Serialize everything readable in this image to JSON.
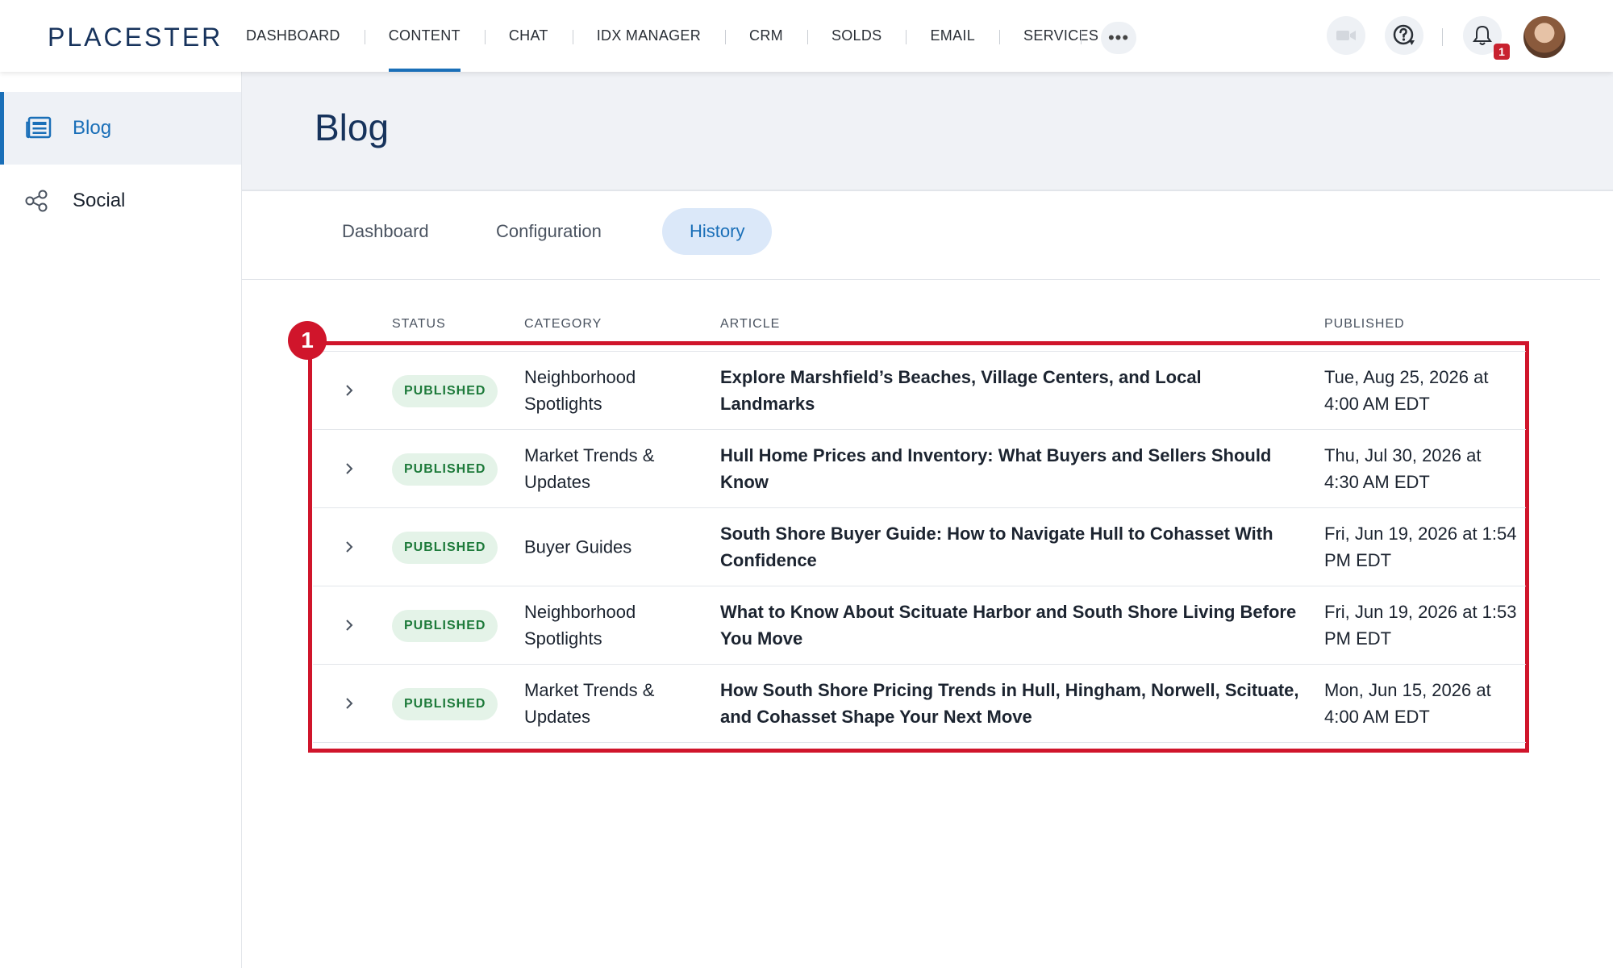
{
  "brand": {
    "logo": "PLACESTER"
  },
  "nav": {
    "items": [
      {
        "label": "DASHBOARD",
        "active": false
      },
      {
        "label": "CONTENT",
        "active": true
      },
      {
        "label": "CHAT",
        "active": false
      },
      {
        "label": "IDX MANAGER",
        "active": false
      },
      {
        "label": "CRM",
        "active": false
      },
      {
        "label": "SOLDS",
        "active": false
      },
      {
        "label": "EMAIL",
        "active": false
      },
      {
        "label": "SERVICES",
        "active": false
      }
    ],
    "more_label": "•••",
    "notification_count": "1"
  },
  "sidebar": {
    "items": [
      {
        "label": "Blog",
        "icon": "newspaper-icon",
        "active": true
      },
      {
        "label": "Social",
        "icon": "share-icon",
        "active": false
      }
    ]
  },
  "page": {
    "title": "Blog"
  },
  "tabs": [
    {
      "label": "Dashboard",
      "active": false
    },
    {
      "label": "Configuration",
      "active": false
    },
    {
      "label": "History",
      "active": true
    }
  ],
  "table": {
    "headers": {
      "status": "STATUS",
      "category": "CATEGORY",
      "article": "ARTICLE",
      "published": "PUBLISHED"
    },
    "rows": [
      {
        "status": "PUBLISHED",
        "category": "Neighborhood Spotlights",
        "article": "Explore Marshfield’s Beaches, Village Centers, and Local Landmarks",
        "published": "Tue, Aug 25, 2026 at 4:00 AM EDT"
      },
      {
        "status": "PUBLISHED",
        "category": "Market Trends & Updates",
        "article": "Hull Home Prices and Inventory: What Buyers and Sellers Should Know",
        "published": "Thu, Jul 30, 2026 at 4:30 AM EDT"
      },
      {
        "status": "PUBLISHED",
        "category": "Buyer Guides",
        "article": "South Shore Buyer Guide: How to Navigate Hull to Cohasset With Confidence",
        "published": "Fri, Jun 19, 2026 at 1:54 PM EDT"
      },
      {
        "status": "PUBLISHED",
        "category": "Neighborhood Spotlights",
        "article": "What to Know About Scituate Harbor and South Shore Living Before You Move",
        "published": "Fri, Jun 19, 2026 at 1:53 PM EDT"
      },
      {
        "status": "PUBLISHED",
        "category": "Market Trends & Updates",
        "article": "How South Shore Pricing Trends in Hull, Hingham, Norwell, Scituate, and Cohasset Shape Your Next Move",
        "published": "Mon, Jun 15, 2026 at 4:00 AM EDT"
      }
    ]
  },
  "annotation": {
    "number": "1"
  },
  "colors": {
    "accent": "#1a6fb8",
    "annotation": "#d0152b",
    "status_green": "#1d7a3a",
    "brand_navy": "#17335c"
  }
}
